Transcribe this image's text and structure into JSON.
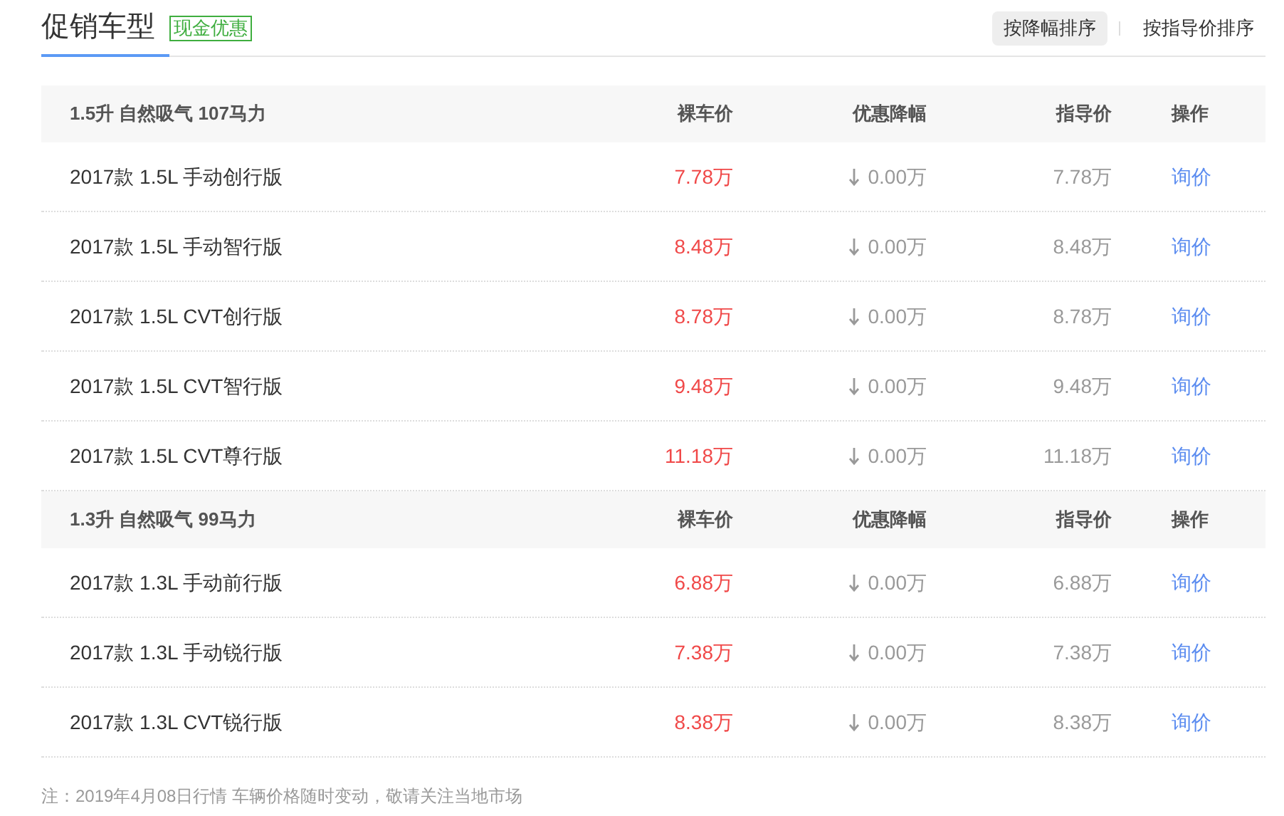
{
  "title": "促销车型",
  "badge": "现金优惠",
  "sort_buttons": [
    {
      "label": "按降幅排序",
      "selected": true
    },
    {
      "label": "按指导价排序",
      "selected": false
    }
  ],
  "groups": [
    {
      "name": "1.5升 自然吸气 107马力",
      "columns": [
        "裸车价",
        "优惠降幅",
        "指导价",
        "操作"
      ],
      "rows": [
        {
          "model": "2017款 1.5L 手动创行版",
          "price": "7.78万",
          "discount": "0.00万",
          "guide": "7.78万",
          "action": "询价"
        },
        {
          "model": "2017款 1.5L 手动智行版",
          "price": "8.48万",
          "discount": "0.00万",
          "guide": "8.48万",
          "action": "询价"
        },
        {
          "model": "2017款 1.5L CVT创行版",
          "price": "8.78万",
          "discount": "0.00万",
          "guide": "8.78万",
          "action": "询价"
        },
        {
          "model": "2017款 1.5L CVT智行版",
          "price": "9.48万",
          "discount": "0.00万",
          "guide": "9.48万",
          "action": "询价"
        },
        {
          "model": "2017款 1.5L CVT尊行版",
          "price": "11.18万",
          "discount": "0.00万",
          "guide": "11.18万",
          "action": "询价"
        }
      ]
    },
    {
      "name": "1.3升 自然吸气 99马力",
      "columns": [
        "裸车价",
        "优惠降幅",
        "指导价",
        "操作"
      ],
      "rows": [
        {
          "model": "2017款 1.3L 手动前行版",
          "price": "6.88万",
          "discount": "0.00万",
          "guide": "6.88万",
          "action": "询价"
        },
        {
          "model": "2017款 1.3L 手动锐行版",
          "price": "7.38万",
          "discount": "0.00万",
          "guide": "7.38万",
          "action": "询价"
        },
        {
          "model": "2017款 1.3L CVT锐行版",
          "price": "8.38万",
          "discount": "0.00万",
          "guide": "8.38万",
          "action": "询价"
        }
      ]
    }
  ],
  "note": "注：2019年4月08日行情 车辆价格随时变动，敬请关注当地市场"
}
